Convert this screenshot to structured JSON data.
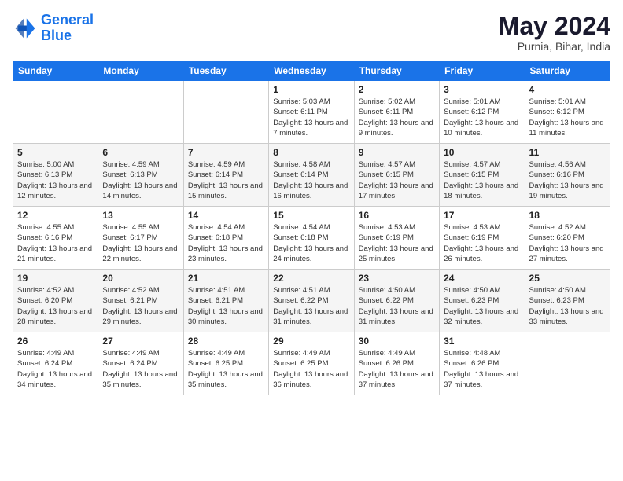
{
  "header": {
    "logo_line1": "General",
    "logo_line2": "Blue",
    "month": "May 2024",
    "location": "Purnia, Bihar, India"
  },
  "days_of_week": [
    "Sunday",
    "Monday",
    "Tuesday",
    "Wednesday",
    "Thursday",
    "Friday",
    "Saturday"
  ],
  "weeks": [
    [
      {
        "day": "",
        "sunrise": "",
        "sunset": "",
        "daylight": ""
      },
      {
        "day": "",
        "sunrise": "",
        "sunset": "",
        "daylight": ""
      },
      {
        "day": "",
        "sunrise": "",
        "sunset": "",
        "daylight": ""
      },
      {
        "day": "1",
        "sunrise": "Sunrise: 5:03 AM",
        "sunset": "Sunset: 6:11 PM",
        "daylight": "Daylight: 13 hours and 7 minutes."
      },
      {
        "day": "2",
        "sunrise": "Sunrise: 5:02 AM",
        "sunset": "Sunset: 6:11 PM",
        "daylight": "Daylight: 13 hours and 9 minutes."
      },
      {
        "day": "3",
        "sunrise": "Sunrise: 5:01 AM",
        "sunset": "Sunset: 6:12 PM",
        "daylight": "Daylight: 13 hours and 10 minutes."
      },
      {
        "day": "4",
        "sunrise": "Sunrise: 5:01 AM",
        "sunset": "Sunset: 6:12 PM",
        "daylight": "Daylight: 13 hours and 11 minutes."
      }
    ],
    [
      {
        "day": "5",
        "sunrise": "Sunrise: 5:00 AM",
        "sunset": "Sunset: 6:13 PM",
        "daylight": "Daylight: 13 hours and 12 minutes."
      },
      {
        "day": "6",
        "sunrise": "Sunrise: 4:59 AM",
        "sunset": "Sunset: 6:13 PM",
        "daylight": "Daylight: 13 hours and 14 minutes."
      },
      {
        "day": "7",
        "sunrise": "Sunrise: 4:59 AM",
        "sunset": "Sunset: 6:14 PM",
        "daylight": "Daylight: 13 hours and 15 minutes."
      },
      {
        "day": "8",
        "sunrise": "Sunrise: 4:58 AM",
        "sunset": "Sunset: 6:14 PM",
        "daylight": "Daylight: 13 hours and 16 minutes."
      },
      {
        "day": "9",
        "sunrise": "Sunrise: 4:57 AM",
        "sunset": "Sunset: 6:15 PM",
        "daylight": "Daylight: 13 hours and 17 minutes."
      },
      {
        "day": "10",
        "sunrise": "Sunrise: 4:57 AM",
        "sunset": "Sunset: 6:15 PM",
        "daylight": "Daylight: 13 hours and 18 minutes."
      },
      {
        "day": "11",
        "sunrise": "Sunrise: 4:56 AM",
        "sunset": "Sunset: 6:16 PM",
        "daylight": "Daylight: 13 hours and 19 minutes."
      }
    ],
    [
      {
        "day": "12",
        "sunrise": "Sunrise: 4:55 AM",
        "sunset": "Sunset: 6:16 PM",
        "daylight": "Daylight: 13 hours and 21 minutes."
      },
      {
        "day": "13",
        "sunrise": "Sunrise: 4:55 AM",
        "sunset": "Sunset: 6:17 PM",
        "daylight": "Daylight: 13 hours and 22 minutes."
      },
      {
        "day": "14",
        "sunrise": "Sunrise: 4:54 AM",
        "sunset": "Sunset: 6:18 PM",
        "daylight": "Daylight: 13 hours and 23 minutes."
      },
      {
        "day": "15",
        "sunrise": "Sunrise: 4:54 AM",
        "sunset": "Sunset: 6:18 PM",
        "daylight": "Daylight: 13 hours and 24 minutes."
      },
      {
        "day": "16",
        "sunrise": "Sunrise: 4:53 AM",
        "sunset": "Sunset: 6:19 PM",
        "daylight": "Daylight: 13 hours and 25 minutes."
      },
      {
        "day": "17",
        "sunrise": "Sunrise: 4:53 AM",
        "sunset": "Sunset: 6:19 PM",
        "daylight": "Daylight: 13 hours and 26 minutes."
      },
      {
        "day": "18",
        "sunrise": "Sunrise: 4:52 AM",
        "sunset": "Sunset: 6:20 PM",
        "daylight": "Daylight: 13 hours and 27 minutes."
      }
    ],
    [
      {
        "day": "19",
        "sunrise": "Sunrise: 4:52 AM",
        "sunset": "Sunset: 6:20 PM",
        "daylight": "Daylight: 13 hours and 28 minutes."
      },
      {
        "day": "20",
        "sunrise": "Sunrise: 4:52 AM",
        "sunset": "Sunset: 6:21 PM",
        "daylight": "Daylight: 13 hours and 29 minutes."
      },
      {
        "day": "21",
        "sunrise": "Sunrise: 4:51 AM",
        "sunset": "Sunset: 6:21 PM",
        "daylight": "Daylight: 13 hours and 30 minutes."
      },
      {
        "day": "22",
        "sunrise": "Sunrise: 4:51 AM",
        "sunset": "Sunset: 6:22 PM",
        "daylight": "Daylight: 13 hours and 31 minutes."
      },
      {
        "day": "23",
        "sunrise": "Sunrise: 4:50 AM",
        "sunset": "Sunset: 6:22 PM",
        "daylight": "Daylight: 13 hours and 31 minutes."
      },
      {
        "day": "24",
        "sunrise": "Sunrise: 4:50 AM",
        "sunset": "Sunset: 6:23 PM",
        "daylight": "Daylight: 13 hours and 32 minutes."
      },
      {
        "day": "25",
        "sunrise": "Sunrise: 4:50 AM",
        "sunset": "Sunset: 6:23 PM",
        "daylight": "Daylight: 13 hours and 33 minutes."
      }
    ],
    [
      {
        "day": "26",
        "sunrise": "Sunrise: 4:49 AM",
        "sunset": "Sunset: 6:24 PM",
        "daylight": "Daylight: 13 hours and 34 minutes."
      },
      {
        "day": "27",
        "sunrise": "Sunrise: 4:49 AM",
        "sunset": "Sunset: 6:24 PM",
        "daylight": "Daylight: 13 hours and 35 minutes."
      },
      {
        "day": "28",
        "sunrise": "Sunrise: 4:49 AM",
        "sunset": "Sunset: 6:25 PM",
        "daylight": "Daylight: 13 hours and 35 minutes."
      },
      {
        "day": "29",
        "sunrise": "Sunrise: 4:49 AM",
        "sunset": "Sunset: 6:25 PM",
        "daylight": "Daylight: 13 hours and 36 minutes."
      },
      {
        "day": "30",
        "sunrise": "Sunrise: 4:49 AM",
        "sunset": "Sunset: 6:26 PM",
        "daylight": "Daylight: 13 hours and 37 minutes."
      },
      {
        "day": "31",
        "sunrise": "Sunrise: 4:48 AM",
        "sunset": "Sunset: 6:26 PM",
        "daylight": "Daylight: 13 hours and 37 minutes."
      },
      {
        "day": "",
        "sunrise": "",
        "sunset": "",
        "daylight": ""
      }
    ]
  ]
}
